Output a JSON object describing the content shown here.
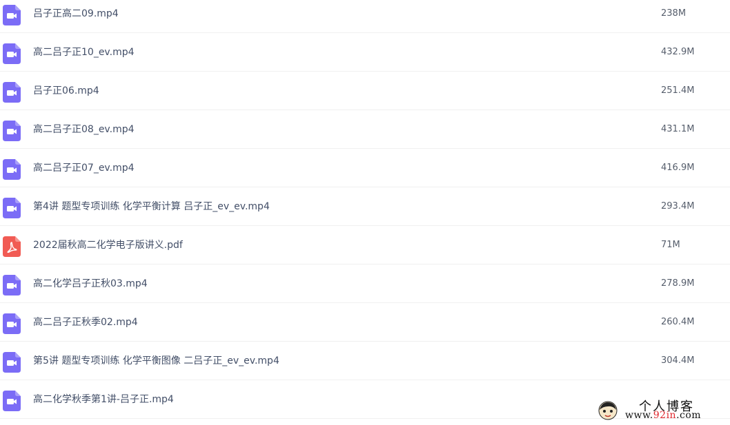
{
  "files": [
    {
      "name": "吕子正高二09.mp4",
      "size": "238M",
      "type": "video"
    },
    {
      "name": "高二吕子正10_ev.mp4",
      "size": "432.9M",
      "type": "video"
    },
    {
      "name": "吕子正06.mp4",
      "size": "251.4M",
      "type": "video"
    },
    {
      "name": "高二吕子正08_ev.mp4",
      "size": "431.1M",
      "type": "video"
    },
    {
      "name": "高二吕子正07_ev.mp4",
      "size": "416.9M",
      "type": "video"
    },
    {
      "name": "第4讲 题型专项训练 化学平衡计算 吕子正_ev_ev.mp4",
      "size": "293.4M",
      "type": "video"
    },
    {
      "name": "2022届秋高二化学电子版讲义.pdf",
      "size": "71M",
      "type": "pdf"
    },
    {
      "name": "高二化学吕子正秋03.mp4",
      "size": "278.9M",
      "type": "video"
    },
    {
      "name": "高二吕子正秋季02.mp4",
      "size": "260.4M",
      "type": "video"
    },
    {
      "name": "第5讲 题型专项训练 化学平衡图像 二吕子正_ev_ev.mp4",
      "size": "304.4M",
      "type": "video"
    },
    {
      "name": "高二化学秋季第1讲-吕子正.mp4",
      "size": "",
      "type": "video"
    }
  ],
  "icons": {
    "video": "video-file-icon",
    "pdf": "pdf-file-icon"
  },
  "colors": {
    "video": "#7b6cf6",
    "pdf": "#f15b54"
  },
  "watermark": {
    "title": "个人博客",
    "url_prefix": "www.",
    "url_highlight": "92in",
    "url_suffix": ".com"
  }
}
